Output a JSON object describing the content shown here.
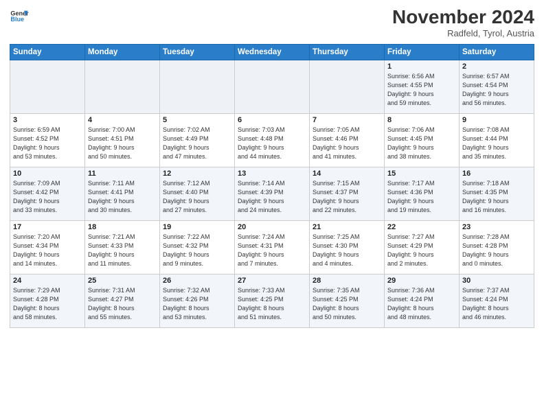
{
  "header": {
    "logo_line1": "General",
    "logo_line2": "Blue",
    "month": "November 2024",
    "location": "Radfeld, Tyrol, Austria"
  },
  "weekdays": [
    "Sunday",
    "Monday",
    "Tuesday",
    "Wednesday",
    "Thursday",
    "Friday",
    "Saturday"
  ],
  "weeks": [
    [
      {
        "day": "",
        "info": ""
      },
      {
        "day": "",
        "info": ""
      },
      {
        "day": "",
        "info": ""
      },
      {
        "day": "",
        "info": ""
      },
      {
        "day": "",
        "info": ""
      },
      {
        "day": "1",
        "info": "Sunrise: 6:56 AM\nSunset: 4:55 PM\nDaylight: 9 hours\nand 59 minutes."
      },
      {
        "day": "2",
        "info": "Sunrise: 6:57 AM\nSunset: 4:54 PM\nDaylight: 9 hours\nand 56 minutes."
      }
    ],
    [
      {
        "day": "3",
        "info": "Sunrise: 6:59 AM\nSunset: 4:52 PM\nDaylight: 9 hours\nand 53 minutes."
      },
      {
        "day": "4",
        "info": "Sunrise: 7:00 AM\nSunset: 4:51 PM\nDaylight: 9 hours\nand 50 minutes."
      },
      {
        "day": "5",
        "info": "Sunrise: 7:02 AM\nSunset: 4:49 PM\nDaylight: 9 hours\nand 47 minutes."
      },
      {
        "day": "6",
        "info": "Sunrise: 7:03 AM\nSunset: 4:48 PM\nDaylight: 9 hours\nand 44 minutes."
      },
      {
        "day": "7",
        "info": "Sunrise: 7:05 AM\nSunset: 4:46 PM\nDaylight: 9 hours\nand 41 minutes."
      },
      {
        "day": "8",
        "info": "Sunrise: 7:06 AM\nSunset: 4:45 PM\nDaylight: 9 hours\nand 38 minutes."
      },
      {
        "day": "9",
        "info": "Sunrise: 7:08 AM\nSunset: 4:44 PM\nDaylight: 9 hours\nand 35 minutes."
      }
    ],
    [
      {
        "day": "10",
        "info": "Sunrise: 7:09 AM\nSunset: 4:42 PM\nDaylight: 9 hours\nand 33 minutes."
      },
      {
        "day": "11",
        "info": "Sunrise: 7:11 AM\nSunset: 4:41 PM\nDaylight: 9 hours\nand 30 minutes."
      },
      {
        "day": "12",
        "info": "Sunrise: 7:12 AM\nSunset: 4:40 PM\nDaylight: 9 hours\nand 27 minutes."
      },
      {
        "day": "13",
        "info": "Sunrise: 7:14 AM\nSunset: 4:39 PM\nDaylight: 9 hours\nand 24 minutes."
      },
      {
        "day": "14",
        "info": "Sunrise: 7:15 AM\nSunset: 4:37 PM\nDaylight: 9 hours\nand 22 minutes."
      },
      {
        "day": "15",
        "info": "Sunrise: 7:17 AM\nSunset: 4:36 PM\nDaylight: 9 hours\nand 19 minutes."
      },
      {
        "day": "16",
        "info": "Sunrise: 7:18 AM\nSunset: 4:35 PM\nDaylight: 9 hours\nand 16 minutes."
      }
    ],
    [
      {
        "day": "17",
        "info": "Sunrise: 7:20 AM\nSunset: 4:34 PM\nDaylight: 9 hours\nand 14 minutes."
      },
      {
        "day": "18",
        "info": "Sunrise: 7:21 AM\nSunset: 4:33 PM\nDaylight: 9 hours\nand 11 minutes."
      },
      {
        "day": "19",
        "info": "Sunrise: 7:22 AM\nSunset: 4:32 PM\nDaylight: 9 hours\nand 9 minutes."
      },
      {
        "day": "20",
        "info": "Sunrise: 7:24 AM\nSunset: 4:31 PM\nDaylight: 9 hours\nand 7 minutes."
      },
      {
        "day": "21",
        "info": "Sunrise: 7:25 AM\nSunset: 4:30 PM\nDaylight: 9 hours\nand 4 minutes."
      },
      {
        "day": "22",
        "info": "Sunrise: 7:27 AM\nSunset: 4:29 PM\nDaylight: 9 hours\nand 2 minutes."
      },
      {
        "day": "23",
        "info": "Sunrise: 7:28 AM\nSunset: 4:28 PM\nDaylight: 9 hours\nand 0 minutes."
      }
    ],
    [
      {
        "day": "24",
        "info": "Sunrise: 7:29 AM\nSunset: 4:28 PM\nDaylight: 8 hours\nand 58 minutes."
      },
      {
        "day": "25",
        "info": "Sunrise: 7:31 AM\nSunset: 4:27 PM\nDaylight: 8 hours\nand 55 minutes."
      },
      {
        "day": "26",
        "info": "Sunrise: 7:32 AM\nSunset: 4:26 PM\nDaylight: 8 hours\nand 53 minutes."
      },
      {
        "day": "27",
        "info": "Sunrise: 7:33 AM\nSunset: 4:25 PM\nDaylight: 8 hours\nand 51 minutes."
      },
      {
        "day": "28",
        "info": "Sunrise: 7:35 AM\nSunset: 4:25 PM\nDaylight: 8 hours\nand 50 minutes."
      },
      {
        "day": "29",
        "info": "Sunrise: 7:36 AM\nSunset: 4:24 PM\nDaylight: 8 hours\nand 48 minutes."
      },
      {
        "day": "30",
        "info": "Sunrise: 7:37 AM\nSunset: 4:24 PM\nDaylight: 8 hours\nand 46 minutes."
      }
    ]
  ]
}
